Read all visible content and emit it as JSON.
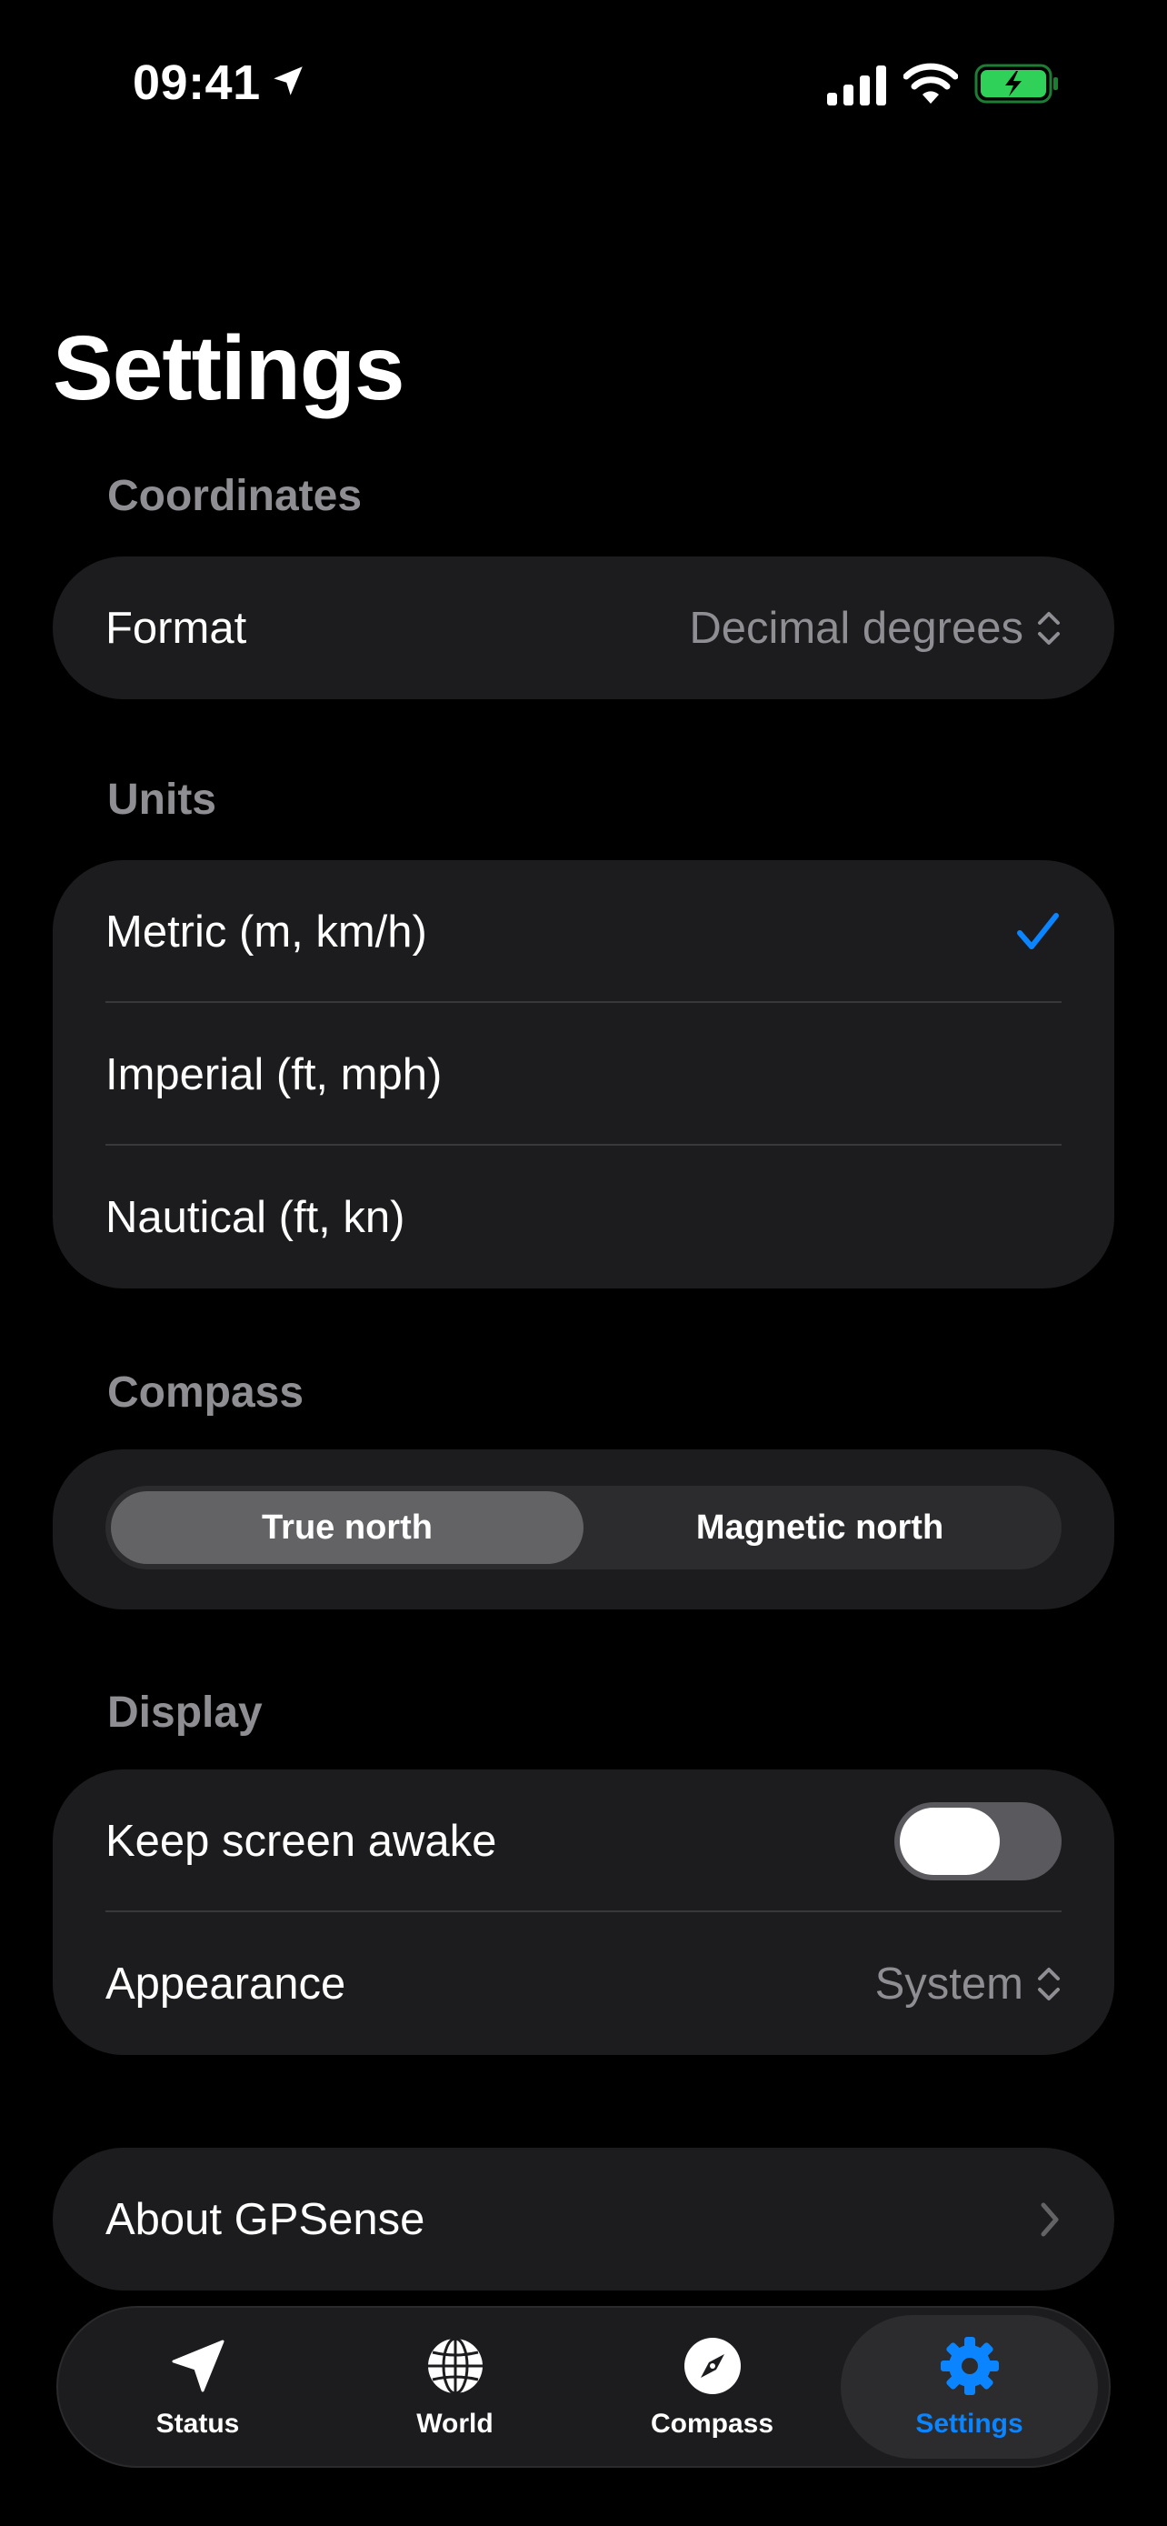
{
  "status_bar": {
    "time": "09:41"
  },
  "page": {
    "title": "Settings"
  },
  "coordinates": {
    "header": "Coordinates",
    "format_label": "Format",
    "format_value": "Decimal degrees"
  },
  "units": {
    "header": "Units",
    "options": [
      {
        "label": "Metric (m, km/h)",
        "selected": true
      },
      {
        "label": "Imperial (ft, mph)",
        "selected": false
      },
      {
        "label": "Nautical (ft, kn)",
        "selected": false
      }
    ]
  },
  "compass": {
    "header": "Compass",
    "segments": [
      "True north",
      "Magnetic north"
    ],
    "selected_index": 0
  },
  "display": {
    "header": "Display",
    "keep_awake_label": "Keep screen awake",
    "keep_awake_on": false,
    "appearance_label": "Appearance",
    "appearance_value": "System"
  },
  "about": {
    "label": "About GPSense"
  },
  "tab_bar": {
    "tabs": [
      {
        "label": "Status",
        "icon": "location-arrow-icon"
      },
      {
        "label": "World",
        "icon": "globe-icon"
      },
      {
        "label": "Compass",
        "icon": "compass-icon"
      },
      {
        "label": "Settings",
        "icon": "gear-icon"
      }
    ],
    "active_index": 3
  },
  "colors": {
    "accent": "#0a84ff",
    "battery": "#30d158",
    "background": "#000000",
    "card": "#1c1c1e"
  }
}
